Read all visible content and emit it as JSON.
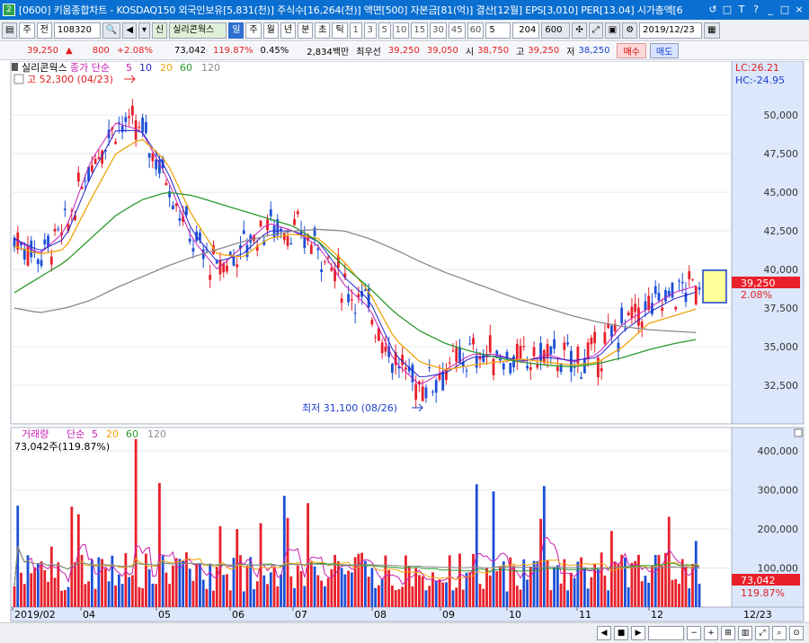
{
  "window": {
    "app_icon": "2",
    "title": "[0600] 키움종합차트 - KOSDAQ150 외국인보유[5,831(천)] 주식수[16,264(천)] 액면[500] 자본금[81(억)] 결산[12월] EPS[3,010] PER[13.04] 시가총액[6",
    "buttons": [
      "↺",
      "□",
      "T",
      "?",
      "_",
      "□",
      "×"
    ]
  },
  "toolbar": {
    "tab_stock": "주",
    "tab_all": "전",
    "code": "108320",
    "badge_credit": "신",
    "stock_name": "실리콘웍스",
    "period_selected": "일",
    "periods": [
      "주",
      "월",
      "년",
      "분",
      "초",
      "틱"
    ],
    "intervals": [
      "1",
      "3",
      "5",
      "10",
      "15",
      "30",
      "45",
      "60"
    ],
    "interval_value": "5",
    "count": "204",
    "count_max": "600",
    "date": "2019/12/23"
  },
  "info": {
    "price": "39,250",
    "change_arrow": "▲",
    "change": "800",
    "change_pct": "+2.08%",
    "volume": "73,042",
    "volume_ratio": "119.87%",
    "turnover": "0.45%",
    "amount": "2,834백만",
    "best_label": "최우선",
    "best_sell": "39,250",
    "best_buy": "39,050",
    "open_label": "시",
    "open": "38,750",
    "high_label": "고",
    "high": "39,250",
    "low_label": "저",
    "low": "38,250",
    "buy_button": "매수",
    "sell_button": "매도"
  },
  "price_panel": {
    "legend_name": "실리콘웍스",
    "legend_ma_label": "종가 단순",
    "ma_periods": [
      "5",
      "10",
      "20",
      "60",
      "120"
    ],
    "high_marker": "고 52,300 (04/23)",
    "low_marker": "최저 31,100 (08/26)",
    "lc": "LC:26.21",
    "hc": "HC:-24.95",
    "current_price_label": "39,250",
    "current_pct_label": "2.08%"
  },
  "volume_panel": {
    "legend_name": "거래량",
    "legend_ma_label": "단순",
    "ma_periods": [
      "5",
      "20",
      "60",
      "120"
    ],
    "current_text": "73,042주(119.87%)",
    "current_volume_label": "73,042",
    "current_pct_label": "119.87%"
  },
  "x_axis": {
    "labels": [
      "2019/02",
      "04",
      "05",
      "06",
      "07",
      "08",
      "09",
      "10",
      "11",
      "12"
    ],
    "end_label": "12/23"
  },
  "colors": {
    "up": "#e8202a",
    "down": "#1c4fd6",
    "ma5": "#c81fb5",
    "ma10": "#2222cc",
    "ma20": "#f0a30a",
    "ma60": "#2a9a2a",
    "ma120": "#8a8a8a",
    "axis_bg": "#dce7fb",
    "current_highlight": "#ffff99"
  },
  "chart_data": [
    {
      "type": "candlestick",
      "title": "실리콘웍스",
      "x": [
        "2019/02",
        "04",
        "05",
        "06",
        "07",
        "08",
        "09",
        "10",
        "11",
        "12"
      ],
      "y_ticks": [
        32500,
        35000,
        37500,
        40000,
        42500,
        45000,
        47500,
        50000
      ],
      "ylim": [
        30000,
        53500
      ],
      "series": [
        {
          "name": "종가 단순 5",
          "values": [
            42000,
            41000,
            42500,
            47000,
            49500,
            49000,
            46000,
            42000,
            40000,
            41500,
            43000,
            42500,
            41500,
            39000,
            37500,
            34000,
            32500,
            33500,
            34500,
            34500,
            34000,
            34500,
            34000,
            34500,
            36500,
            37500,
            38500,
            39000
          ]
        },
        {
          "name": "종가 단순 10",
          "values": [
            42000,
            41200,
            42000,
            46000,
            49000,
            49000,
            46500,
            42500,
            40500,
            41000,
            42500,
            42500,
            41800,
            39500,
            38000,
            34500,
            33000,
            33300,
            34300,
            34400,
            34100,
            34300,
            34100,
            34300,
            36000,
            37200,
            38100,
            38600
          ]
        },
        {
          "name": "종가 단순 20",
          "values": [
            41500,
            41000,
            41300,
            44500,
            47500,
            48500,
            47000,
            43500,
            41000,
            40800,
            42000,
            42300,
            42000,
            40500,
            38500,
            35500,
            34000,
            33500,
            33800,
            34000,
            34200,
            34000,
            33800,
            34000,
            35000,
            36500,
            37000,
            37500
          ]
        },
        {
          "name": "종가 단순 60",
          "values": [
            38500,
            39500,
            40500,
            42000,
            43500,
            44500,
            45000,
            44800,
            44300,
            43800,
            43300,
            42800,
            41800,
            40200,
            38800,
            37200,
            36000,
            35200,
            34700,
            34300,
            34000,
            33800,
            33700,
            33900,
            34300,
            34800,
            35200,
            35500
          ]
        },
        {
          "name": "종가 단순 120",
          "values": [
            37500,
            37200,
            37500,
            38000,
            38800,
            39500,
            40200,
            40800,
            41300,
            41800,
            42200,
            42500,
            42600,
            42500,
            42000,
            41300,
            40500,
            39800,
            39200,
            38600,
            38000,
            37500,
            37000,
            36600,
            36300,
            36100,
            36000,
            35900
          ]
        }
      ]
    },
    {
      "type": "bar",
      "title": "거래량",
      "x": [
        "2019/02",
        "04",
        "05",
        "06",
        "07",
        "08",
        "09",
        "10",
        "11",
        "12"
      ],
      "y_ticks": [
        100000,
        200000,
        300000,
        400000
      ],
      "ylim": [
        0,
        460000
      ],
      "max_volume_day": 430000
    }
  ]
}
